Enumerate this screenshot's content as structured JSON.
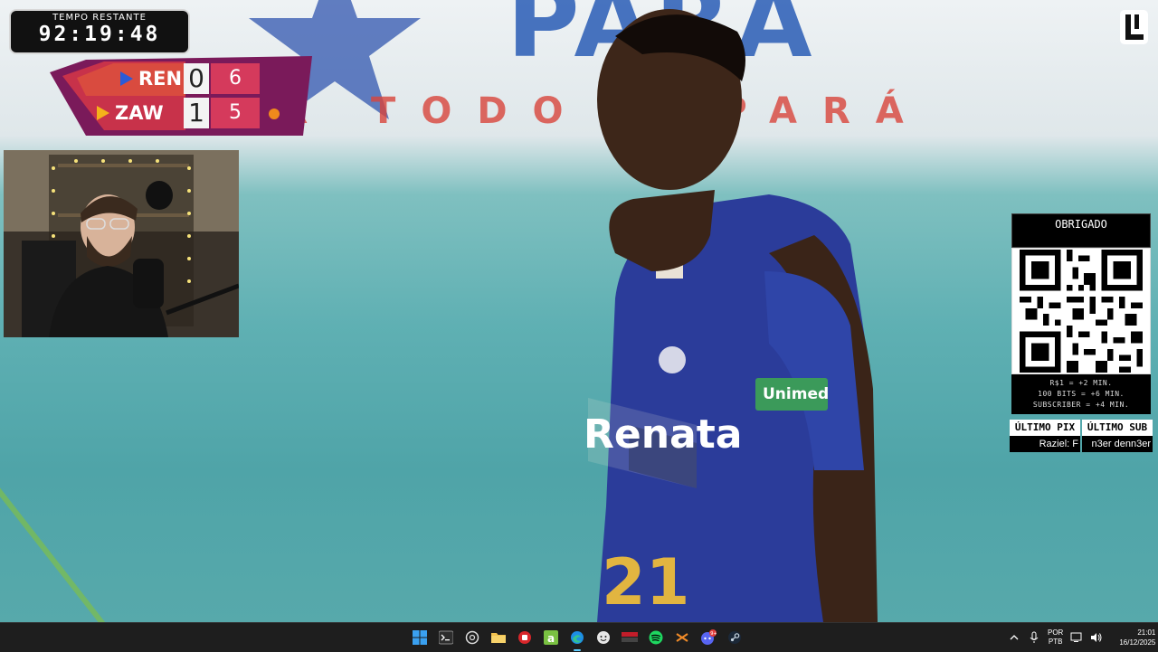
{
  "timer": {
    "label": "TEMPO RESTANTE",
    "value": "92:19:48"
  },
  "scoreboard": {
    "teams": [
      {
        "name": "REN",
        "sets": "0",
        "points": "6",
        "arrow_color": "#2b5bd8"
      },
      {
        "name": "ZAW",
        "sets": "1",
        "points": "5",
        "arrow_color": "#f5b21a"
      }
    ]
  },
  "background": {
    "banner_text": "PARÁ",
    "banner_subtext": "POR TODO O PARÁ",
    "jersey_sponsor": "Renata",
    "jersey_patch": "Unimed",
    "jersey_number": "21"
  },
  "panel": {
    "thanks_title": "OBRIGADO",
    "rates": [
      "R$1 = +2 MIN.",
      "100 BITS = +6 MIN.",
      "SUBSCRIBER = +4 MIN."
    ],
    "last_pix_label": "ÚLTIMO PIX",
    "last_pix_name": "Raziel: F",
    "last_sub_label": "ÚLTIMO SUB",
    "last_sub_name": "n3er denn3er"
  },
  "taskbar": {
    "icons": [
      "windows-start-icon",
      "terminal-icon",
      "chatgpt-icon",
      "file-explorer-icon",
      "red-app-icon",
      "green-a-icon",
      "edge-browser-icon",
      "face-app-icon",
      "red-badge-app-icon",
      "spotify-icon",
      "orange-tool-icon",
      "discord-icon",
      "steam-icon"
    ],
    "discord_badge": "9+",
    "language_line1": "POR",
    "language_line2": "PTB",
    "time": "21:01",
    "date": "16/12/2025"
  },
  "colors": {
    "accent_score": "#d53a5c",
    "scoreboard_purple": "#7a1a5a",
    "serve_dot": "#f08a1c"
  }
}
